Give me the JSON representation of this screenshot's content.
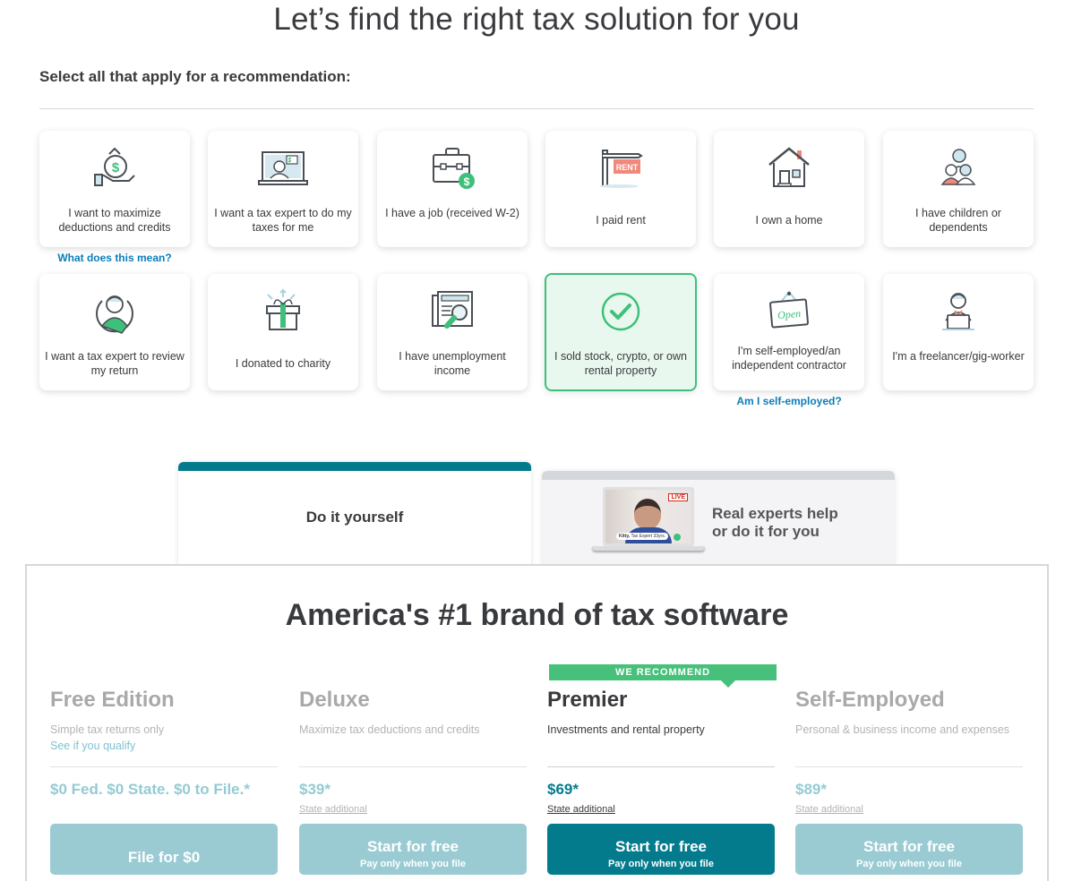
{
  "header": {
    "title": "Let’s find the right tax solution for you",
    "subtitle": "Select all that apply for a recommendation:"
  },
  "cards": [
    {
      "label": "I want to maximize deductions and credits",
      "icon": "money-bag-hand-icon",
      "selected": false
    },
    {
      "label": "I want a tax expert to do my taxes for me",
      "icon": "laptop-expert-icon",
      "selected": false
    },
    {
      "label": "I have a job (received W-2)",
      "icon": "briefcase-dollar-icon",
      "selected": false
    },
    {
      "label": "I paid rent",
      "icon": "rent-sign-icon",
      "selected": false
    },
    {
      "label": "I own a home",
      "icon": "house-icon",
      "selected": false
    },
    {
      "label": "I have children or dependents",
      "icon": "family-icon",
      "selected": false
    },
    {
      "label": "I want a tax expert to review my return",
      "icon": "expert-avatar-icon",
      "selected": false
    },
    {
      "label": "I donated to charity",
      "icon": "gift-icon",
      "selected": false
    },
    {
      "label": "I have unemployment income",
      "icon": "newspaper-magnifier-icon",
      "selected": false
    },
    {
      "label": "I sold stock, crypto, or own rental property",
      "icon": "checkmark-circle-icon",
      "selected": true
    },
    {
      "label": "I'm self-employed/an independent contractor",
      "icon": "open-sign-icon",
      "selected": false
    },
    {
      "label": "I'm a freelancer/gig-worker",
      "icon": "person-laptop-icon",
      "selected": false
    }
  ],
  "helpers": {
    "deductions": "What does this mean?",
    "self_employed": "Am I self-employed?"
  },
  "tabs": {
    "diy": "Do it yourself",
    "expert": "Real experts help or do it for you",
    "expert_line1": "Real experts help",
    "expert_line2": "or do it for you",
    "video": {
      "live_badge": "LIVE",
      "caption_name": "Kitty,",
      "caption_role": "Tax Expert 33yrs."
    }
  },
  "panel": {
    "title": "America's #1 brand of tax software",
    "recommend_badge": "WE RECOMMEND",
    "plans": [
      {
        "name": "Free Edition",
        "desc": "Simple tax returns only",
        "link": "See if you qualify",
        "price": "$0 Fed. $0 State. $0 to File.*",
        "state": "",
        "cta": "File for $0",
        "cta_sub": "",
        "active": false
      },
      {
        "name": "Deluxe",
        "desc": "Maximize tax deductions and credits",
        "link": "",
        "price": "$39*",
        "state": "State additional",
        "cta": "Start for free",
        "cta_sub": "Pay only when you file",
        "active": false
      },
      {
        "name": "Premier",
        "desc": "Investments and rental property",
        "link": "",
        "price": "$69*",
        "state": "State additional",
        "cta": "Start for free",
        "cta_sub": "Pay only when you file",
        "active": true
      },
      {
        "name": "Self-Employed",
        "desc": "Personal & business income and expenses",
        "link": "",
        "price": "$89*",
        "state": "State additional",
        "cta": "Start for free",
        "cta_sub": "Pay only when you file",
        "active": false
      }
    ]
  },
  "colors": {
    "brand_teal": "#047b8d",
    "selected_green": "#3ec07a",
    "link_blue": "#0a7db8",
    "disabled_teal": "#9acbd3"
  }
}
